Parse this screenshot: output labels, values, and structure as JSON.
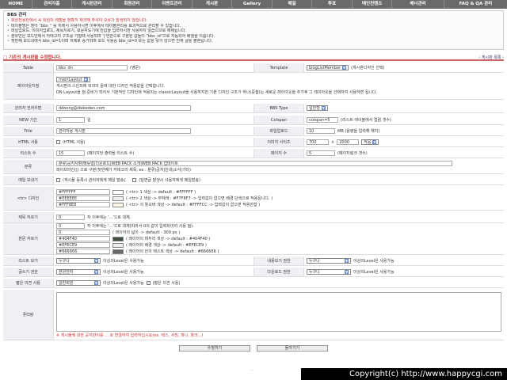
{
  "nav": [
    "HOME",
    "관리자홈",
    "게시판관리",
    "회원관리",
    "이벤트관리",
    "게시판",
    "Gallery",
    "메일",
    "투표",
    "메인컨텐츠",
    "배너관리",
    "FAQ & QA 관리"
  ],
  "info": {
    "title": "BBS 관리",
    "lines": [
      "회원전용란에서 꼭 회원의 레벨을 정확히 체크해 주셔야 오류가 발생되지 않습니다.",
      "테이블명은 영어 \"bbs_\" 를 뒤에서 사용하시면 이후에서 테이블관리를 효과적으로 관리할 수 있습니다.",
      "파일업로드, 이미지업로드, 제목지로기, 보문자도기에 반값을 입력하시면 사용하지 않습으므로 해제됩니다.",
      "분류만은 보드안에서 카테고리 구조를 가질때 사용되며 '|'연관으로 구분된 값들이 \"bbs_id\"으로 자동되어 배열을 이룹니다.",
      "켓번째 보드내에서 bbs_id=1이며 처례로 증가되며 보드 사용중 bbs_id=0 또는 값을 넣거 않으면 전체 글을 볼렌됩니다."
    ]
  },
  "section": {
    "title": "기존의 게시판을 수정합니다.",
    "back_link": "게시판 목록"
  },
  "form": {
    "table_label": "Table",
    "table_value": "bbs_dn",
    "table_note": "(영문)",
    "template_label": "Template",
    "template_value": "blogListMember",
    "template_note": "(게시판디자인 선택)",
    "layout_label": "레이아웃지정",
    "layout_value": "mainLayout",
    "layout_line1": "게시판의 스킨외에 외곽의 틀에 대한 디자인 적용값을 선택합니다.",
    "layout_line2": "DN Layout을 첨 준비가 되어서 기본적인 디자인에 적용되는 classicLayout을 사용하지만 기본 디자인 구조가 하나(중첩)는 새로운 레이아웃을 추가후 그 레이아웃을 선택하여 사용하면 됩니다.",
    "admin_email_label": "관리자 전자우편",
    "admin_email_value": "ddoong@dwkeden.com",
    "bbs_type_label": "BBS Type",
    "bbs_type_value": "일반형",
    "new_label": "NEW 기간",
    "new_value": "1",
    "new_unit": "일",
    "colspan_label": "Colspan",
    "colspan_value": "colspan=5",
    "colspan_note": "(리스트 테이블에서 컬럼 갯수)",
    "title_label": "Title",
    "title_value": "관리자용 게시판",
    "upload_label": "파일업로드",
    "upload_value": "10",
    "upload_note": "MB (용량을 입력해 해지)",
    "html_label": "HTML 사용",
    "html_option": "HTML 사용",
    "img_size_label": "이미지 사이즈",
    "img_w": "700",
    "img_sep": "×",
    "img_h": "2000",
    "img_align": "작음",
    "list_count_label": "리스트 수",
    "list_count_value": "15",
    "list_count_note": "(페이지당 출력될 리스트 수)",
    "page_count_label": "페이지 수",
    "page_count_value": "5",
    "page_count_note": "(페이지링크 갯수)",
    "category_label": "분류",
    "category_value": "분류|공지사항|메뉴얼|다운로드|WEB PACK 소개|WEB PACK 업데이트",
    "category_note": "파이프라인(|) 으로 구분(첫번째가 카테고리 제목, ex : 분류|공지|안내|소식|기타)",
    "mail_label": "메일 보내기",
    "mail_opt1": "게시물 등록시 관리자에게 메일 발송",
    "mail_opt2": "답변글 발생시 사용자에게 메일발송",
    "design_label": "<tr> 디자인",
    "c1": "#FFFFFF",
    "c1_note": "( <tr> 1 색상 -> default : #FFFFFF )",
    "c2": "#EEEEEE",
    "c2_note": "( <tr> 2 색상 -> 무채색 : #F7F8F7 -> 입력값이 없으면 배경 단색으로 적용됩니다. )",
    "c3": "#FFF8E8",
    "c3_note": "( <tr> 의 툴오버 색상 -> default : #FFFFCC -> 입력값이 없으면 적용안함 )",
    "title_cut_label": "제목 자르기",
    "title_cut_value": "0",
    "title_cut_note": "자 이후에는 '...'으로 대체.",
    "body_cut_label": "본문 자르기",
    "body_cut_value": "0",
    "body_cut_note": "자 이후에는 '...'으로 대체(따라서 0의 값이 입력되어야 사용 됨).",
    "body_w": "0",
    "body_w_note": "( 레이어의 넓이 -> default : 300 px )",
    "body_c1": "#404F40",
    "body_c1_note": "( 레이어의 테두리 색상 -> default : #404F40 )",
    "body_c2": "#EFECE9",
    "body_c2_note": "( 레이어의 배경 색상 -> default : #EFECE9 )",
    "body_c3": "#666666",
    "body_c3_note": "( 레이어의 안의 텍스트 색상 -> default : #666666 )",
    "list_view_label": "리스트 보기",
    "list_view_value": "누구나",
    "list_view_note": "이상의Level은 사용가능",
    "content_view_label": "내용보기 권한",
    "content_view_value": "누구나",
    "content_view_note": "이상의Level은 사용가능",
    "write_label": "글쓰기 권한",
    "write_value": "본원전자",
    "write_note": "이상의Level은 사용가능",
    "download_label": "다운로드 권한",
    "download_value": "누구나",
    "download_note": "이상의Level은 사용가능",
    "comment_label": "짧은 의견 사용",
    "comment_value": "일반회원",
    "comment_note": "이상의Level은 사용가능",
    "comment_opt": "(짧은 의견 사용)",
    "footer_label": "풋터랑",
    "footer_warn": "※ 게시물에 대한 공지만이를 ... 로 연결하여 입력하십시요(ex. 텍스, 서빙, 파니, 항크...)"
  },
  "buttons": {
    "submit": "수정하기",
    "back": "돌아가기"
  },
  "dots": "...",
  "copyright": "Copyright(c) http://www.happycgi.com"
}
